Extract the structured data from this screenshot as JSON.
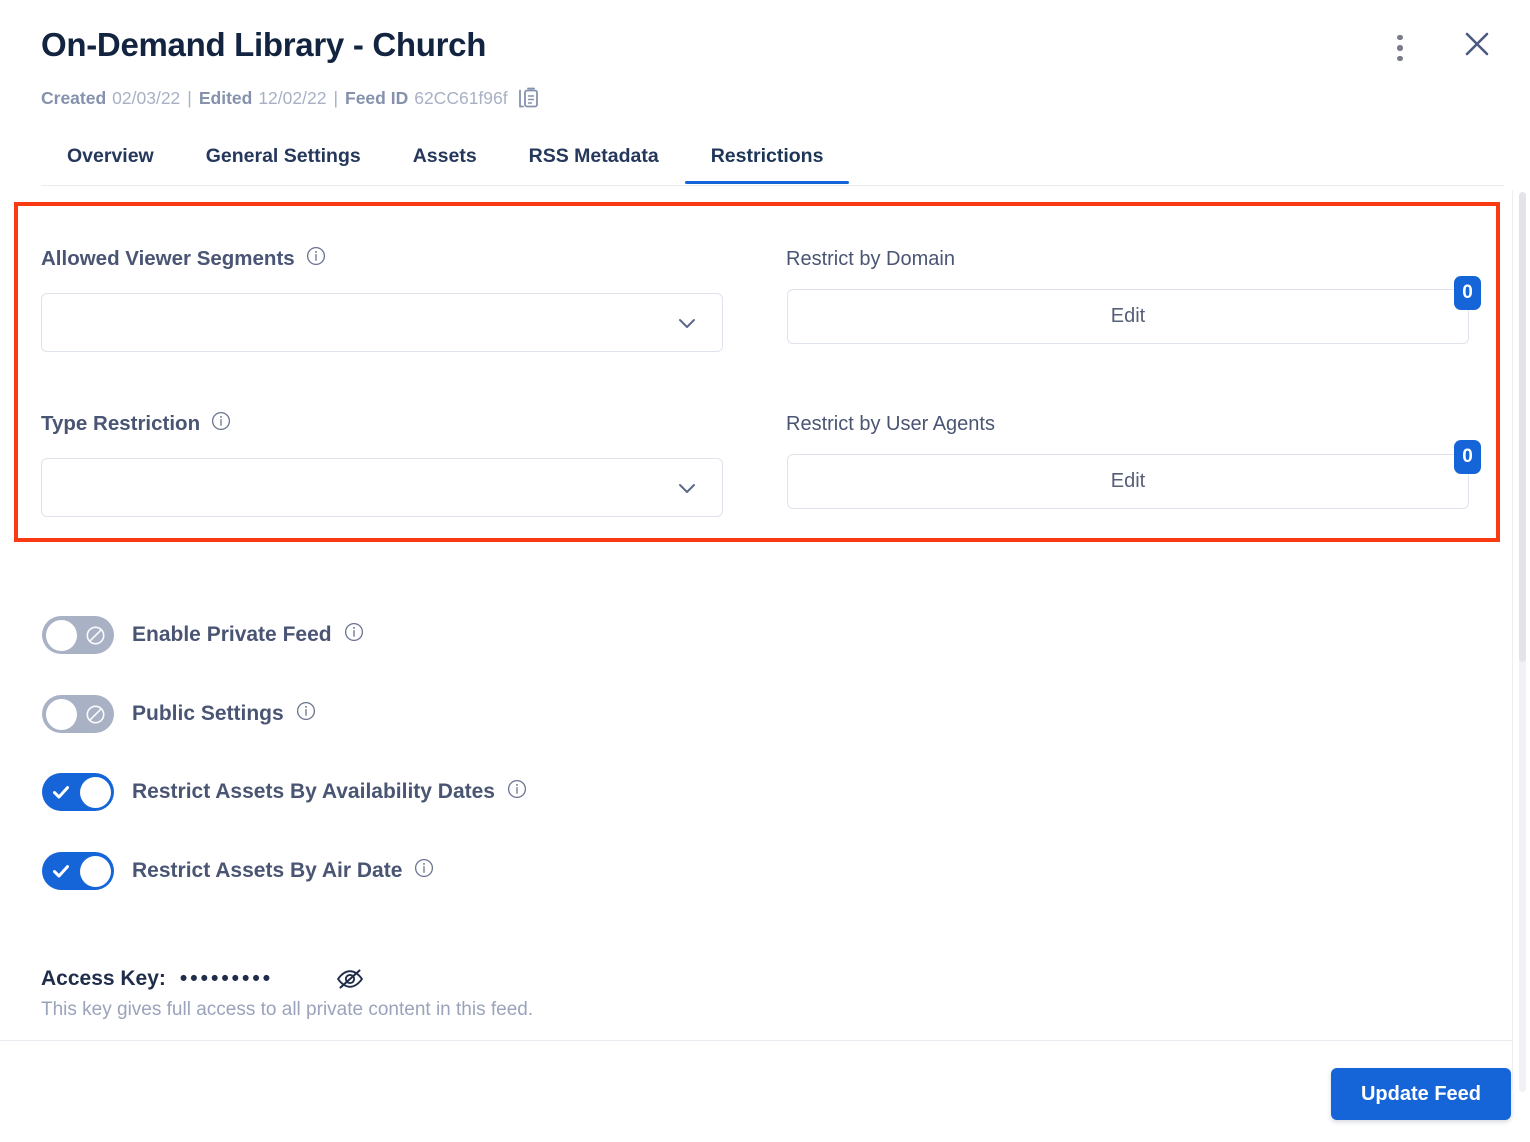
{
  "header": {
    "title": "On-Demand Library - Church",
    "meta": {
      "created_label": "Created",
      "created_value": "02/03/22",
      "sep1": "|",
      "edited_label": "Edited",
      "edited_value": "12/02/22",
      "sep2": "|",
      "feed_id_label": "Feed ID",
      "feed_id_value": "62CC61f96f"
    },
    "copy_icon": "copy-icon",
    "kebab_icon": "more-vertical-icon",
    "close_icon": "close-icon"
  },
  "tabs": [
    {
      "label": "Overview",
      "active": false
    },
    {
      "label": "General Settings",
      "active": false
    },
    {
      "label": "Assets",
      "active": false
    },
    {
      "label": "RSS Metadata",
      "active": false
    },
    {
      "label": "Restrictions",
      "active": true
    }
  ],
  "restrictions": {
    "allowed_viewer_segments": {
      "label": "Allowed Viewer Segments",
      "value": "",
      "placeholder": "",
      "info_icon": "info-icon",
      "chevron_icon": "chevron-down-icon"
    },
    "type_restriction": {
      "label": "Type Restriction",
      "value": "",
      "placeholder": "",
      "info_icon": "info-icon",
      "chevron_icon": "chevron-down-icon"
    },
    "restrict_by_domain": {
      "label": "Restrict by Domain",
      "button_label": "Edit",
      "count": "0"
    },
    "restrict_by_user_agents": {
      "label": "Restrict by User Agents",
      "button_label": "Edit",
      "count": "0"
    }
  },
  "toggles": [
    {
      "label": "Enable Private Feed",
      "state": "off",
      "info_icon": "info-icon"
    },
    {
      "label": "Public Settings",
      "state": "off",
      "info_icon": "info-icon"
    },
    {
      "label": "Restrict Assets By Availability Dates",
      "state": "on",
      "info_icon": "info-icon"
    },
    {
      "label": "Restrict Assets By Air Date",
      "state": "on",
      "info_icon": "info-icon"
    }
  ],
  "access_key": {
    "label": "Access Key:",
    "masked_value": "•••••••••",
    "visibility_icon": "eye-off-icon",
    "note": "This key gives full access to all private content in this feed."
  },
  "footer": {
    "update_label": "Update Feed"
  },
  "colors": {
    "accent": "#1565d8",
    "highlight_border": "#f93a13",
    "title": "#12243f",
    "muted": "#9aa3bb",
    "toggle_off": "#a9b1c5"
  }
}
